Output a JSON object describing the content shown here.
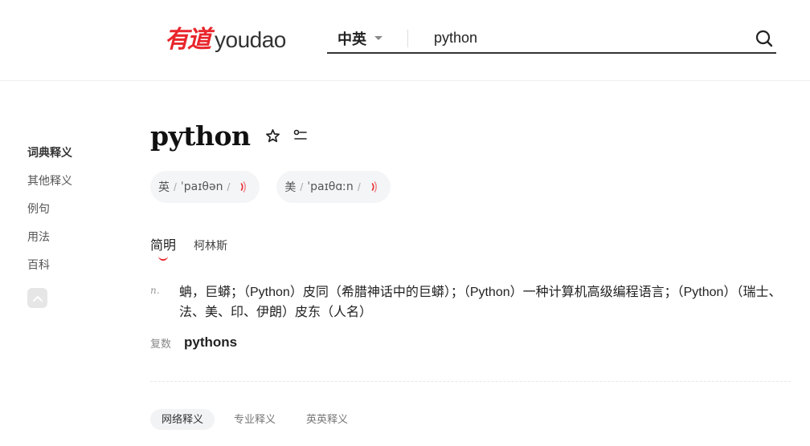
{
  "header": {
    "logo_cn": "有道",
    "logo_en": "youdao",
    "lang_select": "中英",
    "search_value": "python"
  },
  "sidebar": {
    "items": [
      {
        "label": "词典释义"
      },
      {
        "label": "其他释义"
      },
      {
        "label": "例句"
      },
      {
        "label": "用法"
      },
      {
        "label": "百科"
      }
    ]
  },
  "entry": {
    "word": "python",
    "phonetics": [
      {
        "region": "英",
        "ipa": "ˈpaɪθən"
      },
      {
        "region": "美",
        "ipa": "ˈpaɪθɑːn"
      }
    ],
    "dict_tabs": [
      {
        "label": "简明"
      },
      {
        "label": "柯林斯"
      }
    ],
    "definition": {
      "pos": "n.",
      "text": "蚺，巨蟒；（Python）皮同（希腊神话中的巨蟒）；（Python）一种计算机高级编程语言；（Python）（瑞士、法、美、印、伊朗）皮东（人名）"
    },
    "plural": {
      "label": "复数",
      "word": "pythons"
    },
    "sub_tabs": [
      {
        "label": "网络释义"
      },
      {
        "label": "专业释义"
      },
      {
        "label": "英英释义"
      }
    ]
  },
  "colors": {
    "brand_red": "#e8262c",
    "text_dark": "#222222",
    "pill_bg": "#f4f5f7"
  }
}
